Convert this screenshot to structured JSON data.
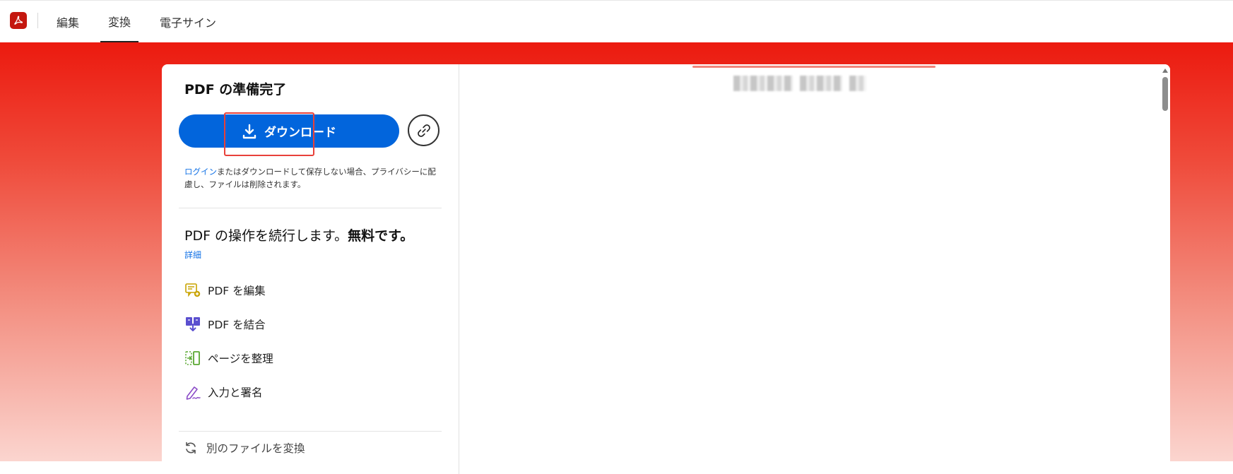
{
  "header": {
    "app_logo": "acrobat-logo-icon",
    "tabs": [
      {
        "label": "編集",
        "active": false
      },
      {
        "label": "変換",
        "active": true
      },
      {
        "label": "電子サイン",
        "active": false
      }
    ]
  },
  "panel": {
    "title": "PDF の準備完了",
    "download_label": "ダウンロード",
    "download_icon": "download-icon",
    "share_link_icon": "link-icon",
    "privacy": {
      "login_link": "ログイン",
      "text": "またはダウンロードして保存しない場合、プライバシーに配慮し、ファイルは削除されます。"
    },
    "continue": {
      "text": "PDF の操作を続行します。",
      "bold": "無料です。",
      "details_link": "詳細"
    },
    "tools": [
      {
        "label": "PDF を編集",
        "icon": "edit-pdf-icon"
      },
      {
        "label": "PDF を結合",
        "icon": "combine-pdf-icon"
      },
      {
        "label": "ページを整理",
        "icon": "organize-pages-icon"
      },
      {
        "label": "入力と署名",
        "icon": "fill-sign-icon"
      }
    ],
    "convert_other": {
      "label": "別のファイルを変換",
      "icon": "refresh-icon"
    }
  },
  "colors": {
    "brand_red": "#ec1a0f",
    "primary_blue": "#0265dc",
    "link_blue": "#1473e6"
  }
}
